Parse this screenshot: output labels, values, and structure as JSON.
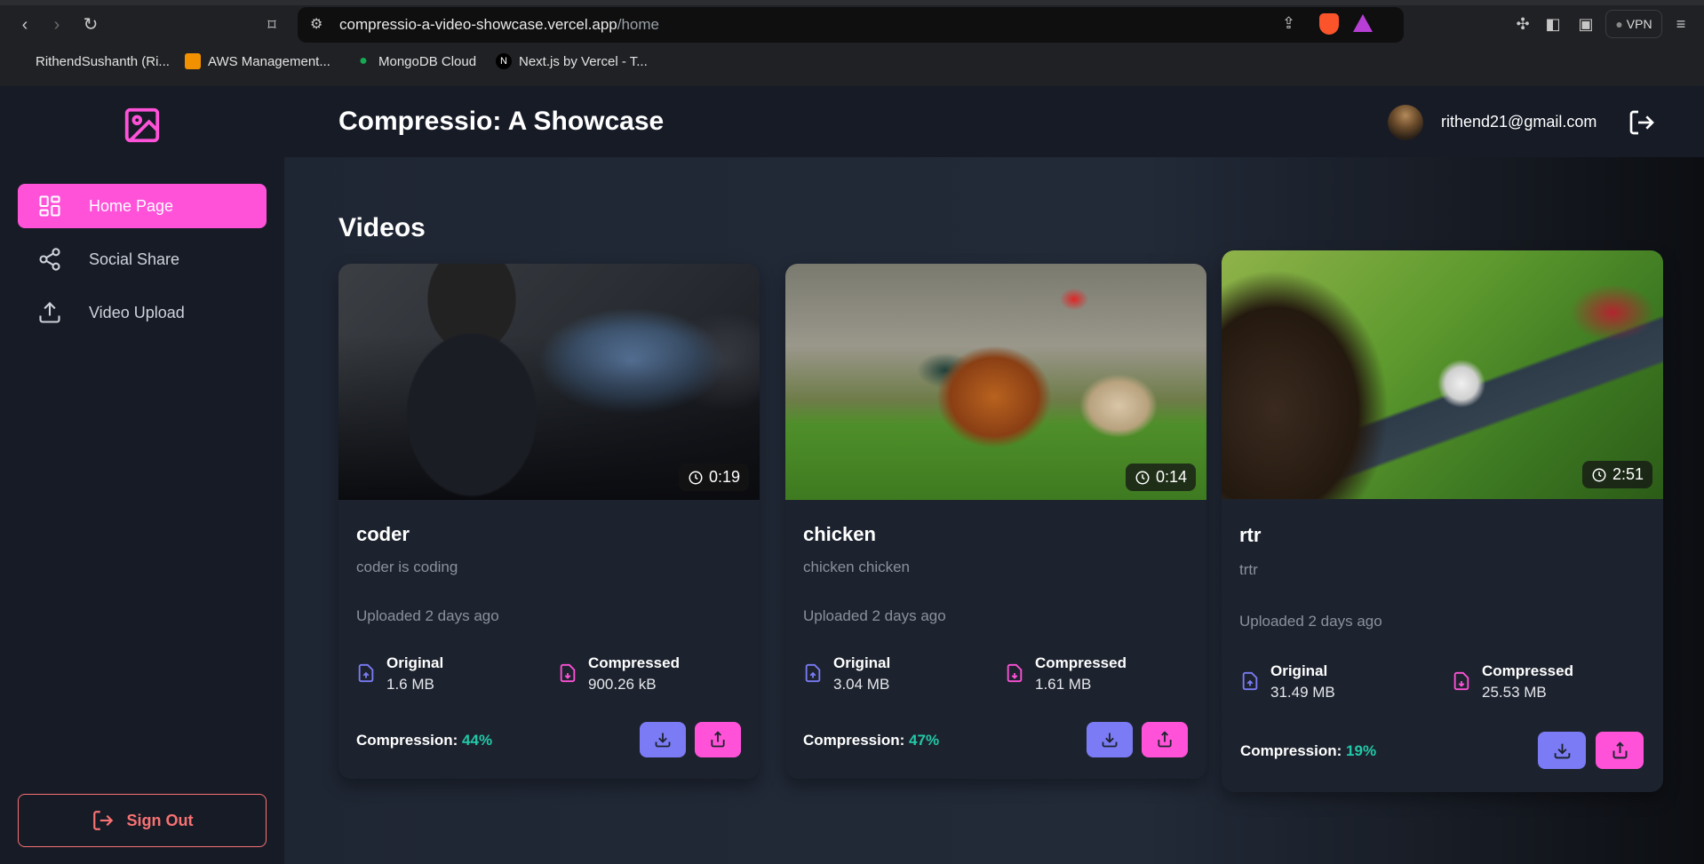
{
  "browser": {
    "url_host": "compressio-a-video-showcase.vercel.app",
    "url_path": "/home",
    "vpn_label": "VPN",
    "bookmarks": [
      {
        "label": "RithendSushanth (Ri..."
      },
      {
        "label": "AWS Management..."
      },
      {
        "label": "MongoDB Cloud"
      },
      {
        "label": "Next.js by Vercel - T..."
      }
    ]
  },
  "header": {
    "title": "Compressio: A Showcase",
    "email": "rithend21@gmail.com"
  },
  "sidebar": {
    "items": [
      {
        "label": "Home Page",
        "icon": "dashboard-icon",
        "active": true
      },
      {
        "label": "Social Share",
        "icon": "share-icon",
        "active": false
      },
      {
        "label": "Video Upload",
        "icon": "upload-icon",
        "active": false
      }
    ],
    "sign_out": "Sign Out"
  },
  "main": {
    "section_title": "Videos",
    "videos": [
      {
        "title": "coder",
        "description": "coder is coding",
        "duration": "0:19",
        "uploaded": "Uploaded 2 days ago",
        "original_label": "Original",
        "original": "1.6 MB",
        "compressed_label": "Compressed",
        "compressed": "900.26 kB",
        "compression_label": "Compression:",
        "compression": "44%"
      },
      {
        "title": "chicken",
        "description": "chicken chicken",
        "duration": "0:14",
        "uploaded": "Uploaded 2 days ago",
        "original_label": "Original",
        "original": "3.04 MB",
        "compressed_label": "Compressed",
        "compressed": "1.61 MB",
        "compression_label": "Compression:",
        "compression": "47%"
      },
      {
        "title": "rtr",
        "description": "trtr",
        "duration": "2:51",
        "uploaded": "Uploaded 2 days ago",
        "original_label": "Original",
        "original": "31.49 MB",
        "compressed_label": "Compressed",
        "compressed": "25.53 MB",
        "compression_label": "Compression:",
        "compression": "19%"
      }
    ]
  },
  "colors": {
    "accent_pink": "#ff52d9",
    "accent_indigo": "#7b7cf5",
    "success_teal": "#22c9a8",
    "danger": "#f87272"
  }
}
